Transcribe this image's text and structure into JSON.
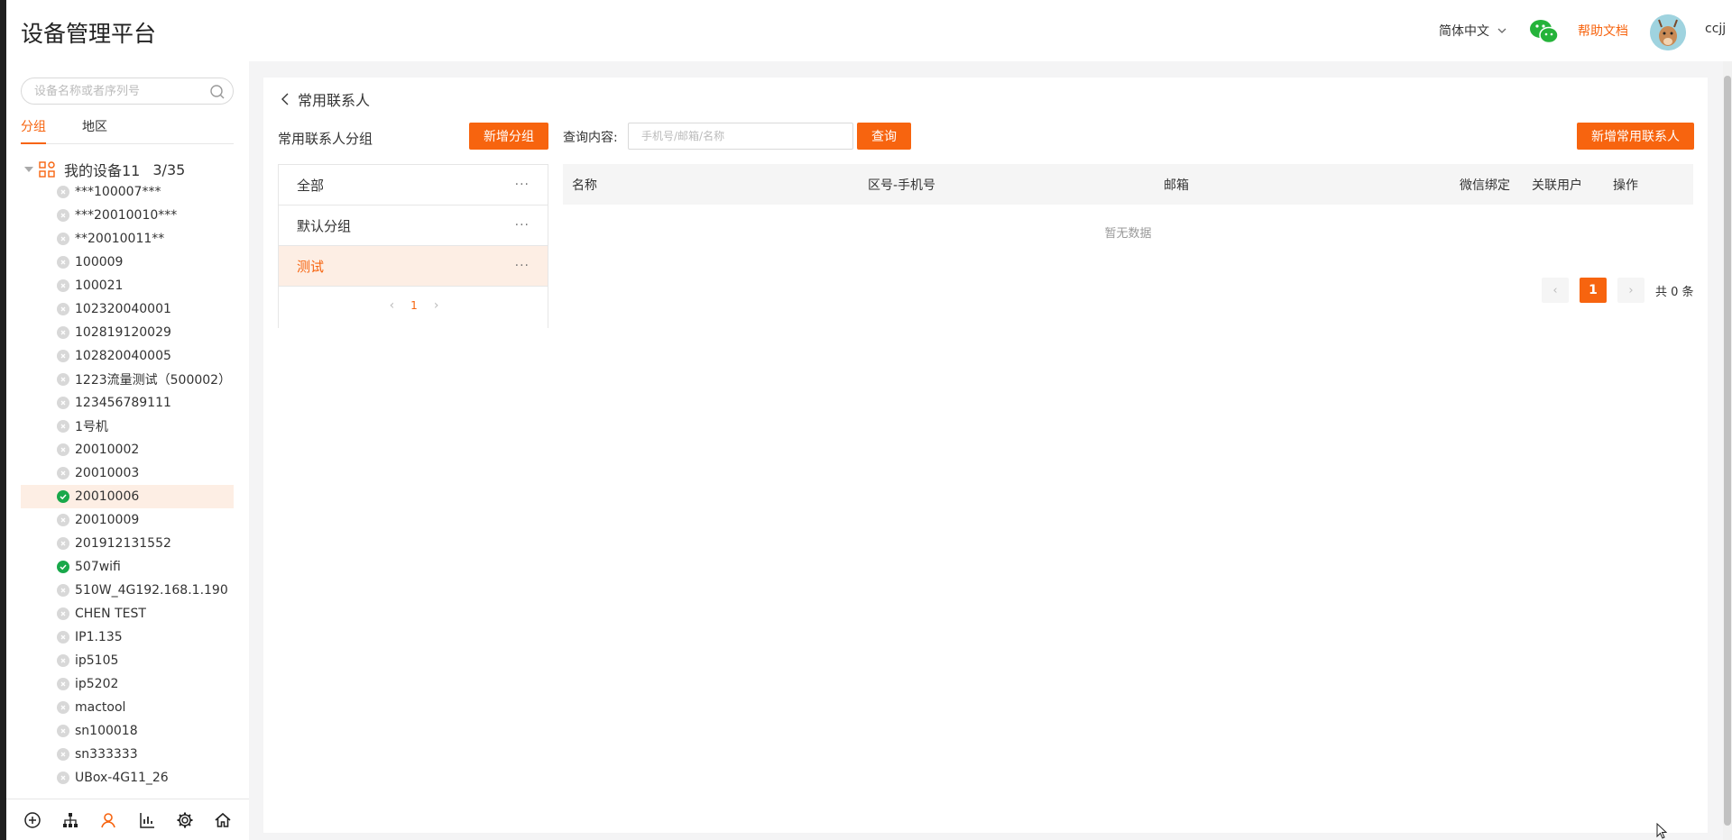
{
  "header": {
    "title": "设备管理平台",
    "language": "简体中文",
    "help": "帮助文档",
    "username": "ccjj"
  },
  "sidebar": {
    "search_placeholder": "设备名称或者序列号",
    "tabs": [
      "分组",
      "地区"
    ],
    "tree_root": {
      "label": "我的设备11",
      "count": "3/35"
    },
    "devices": [
      {
        "name": "***100007***",
        "online": false
      },
      {
        "name": "***20010010***",
        "online": false
      },
      {
        "name": "**20010011**",
        "online": false
      },
      {
        "name": "100009",
        "online": false
      },
      {
        "name": "100021",
        "online": false
      },
      {
        "name": "102320040001",
        "online": false
      },
      {
        "name": "102819120029",
        "online": false
      },
      {
        "name": "102820040005",
        "online": false
      },
      {
        "name": "1223流量测试（500002）",
        "online": false
      },
      {
        "name": "123456789111",
        "online": false
      },
      {
        "name": "1号机",
        "online": false
      },
      {
        "name": "20010002",
        "online": false
      },
      {
        "name": "20010003",
        "online": false
      },
      {
        "name": "20010006",
        "online": true,
        "selected": true
      },
      {
        "name": "20010009",
        "online": false
      },
      {
        "name": "201912131552",
        "online": false
      },
      {
        "name": "507wifi",
        "online": true
      },
      {
        "name": "510W_4G192.168.1.190",
        "online": false
      },
      {
        "name": "CHEN TEST",
        "online": false
      },
      {
        "name": "IP1.135",
        "online": false
      },
      {
        "name": "ip5105",
        "online": false
      },
      {
        "name": "ip5202",
        "online": false
      },
      {
        "name": "mactool",
        "online": false
      },
      {
        "name": "sn100018",
        "online": false
      },
      {
        "name": "sn333333",
        "online": false
      },
      {
        "name": "UBox-4G11_26",
        "online": false
      }
    ],
    "bottom_icons": [
      "plus-circle-icon",
      "org-tree-icon",
      "user-icon",
      "chart-icon",
      "settings-icon",
      "home-icon"
    ]
  },
  "main": {
    "breadcrumb": "常用联系人",
    "group_title": "常用联系人分组",
    "add_group": "新增分组",
    "query_label": "查询内容:",
    "query_placeholder": "手机号/邮箱/名称",
    "query_button": "查询",
    "add_contact": "新增常用联系人",
    "groups": [
      {
        "name": "全部",
        "active": false
      },
      {
        "name": "默认分组",
        "active": false
      },
      {
        "name": "测试",
        "active": true
      }
    ],
    "group_page": "1",
    "columns": [
      "名称",
      "区号-手机号",
      "邮箱",
      "微信绑定",
      "关联用户",
      "操作"
    ],
    "empty_text": "暂无数据",
    "pagination": {
      "current": "1",
      "total": "共 0 条"
    }
  },
  "colors": {
    "accent": "#f7640f",
    "online": "#19a84a",
    "selected_bg": "#fdeee4"
  }
}
